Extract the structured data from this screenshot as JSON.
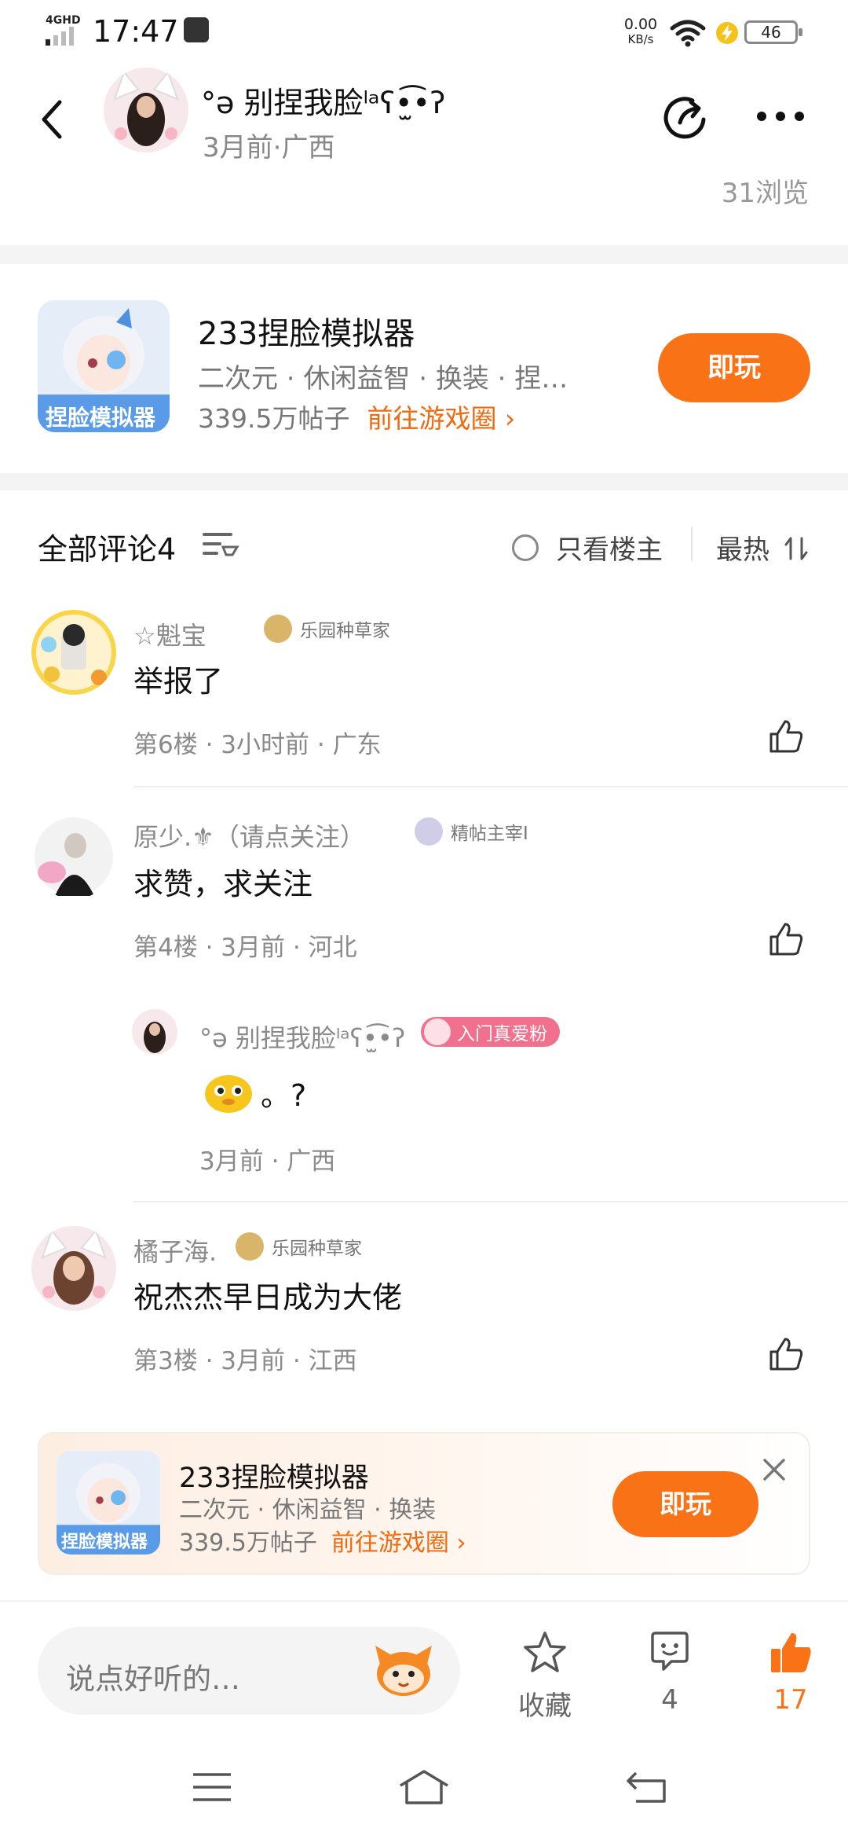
{
  "status_bar": {
    "network": "4GHD",
    "time": "17:47",
    "speed_value": "0.00",
    "speed_unit": "KB/s",
    "battery": "46"
  },
  "header": {
    "author_name": "°ə 别捏我脸ˡᵃʕ•̫͡•ʔ",
    "meta": "3月前·广西",
    "views": "31浏览"
  },
  "game_card": {
    "title": "233捏脸模拟器",
    "tags": "二次元 · 休闲益智 · 换装 · 捏…",
    "posts": "339.5万帖子",
    "link": "前往游戏圈",
    "play_label": "即玩",
    "icon_text": "捏脸模拟器"
  },
  "comments_header": {
    "title": "全部评论4",
    "only_host": "只看楼主",
    "sort": "最热"
  },
  "comments": [
    {
      "name": "☆魁宝",
      "badge": "乐园种草家",
      "text": "举报了",
      "meta": "第6楼 · 3小时前 · 广东"
    },
    {
      "name": "原少.⚜（请点关注）",
      "badge": "精帖主宰Ⅰ",
      "text": "求赞，求关注",
      "meta": "第4楼 · 3月前 · 河北",
      "reply": {
        "name": "°ə 别捏我脸ˡᵃʕ•̫͡•ʔ",
        "badge": "入门真爱粉",
        "text": "。?",
        "meta": "3月前 · 广西"
      }
    },
    {
      "name": "橘子海.",
      "badge": "乐园种草家",
      "text": "祝杰杰早日成为大佬",
      "meta": "第3楼 · 3月前 · 江西"
    }
  ],
  "banner": {
    "title": "233捏脸模拟器",
    "tags": "二次元 · 休闲益智 · 换装",
    "posts": "339.5万帖子",
    "link": "前往游戏圈",
    "play_label": "即玩"
  },
  "bottom_bar": {
    "input_placeholder": "说点好听的…",
    "favorite_label": "收藏",
    "comment_count": "4",
    "like_count": "17"
  },
  "colors": {
    "accent": "#f97316",
    "link": "#f06a10",
    "pink_badge": "#f0708e"
  }
}
